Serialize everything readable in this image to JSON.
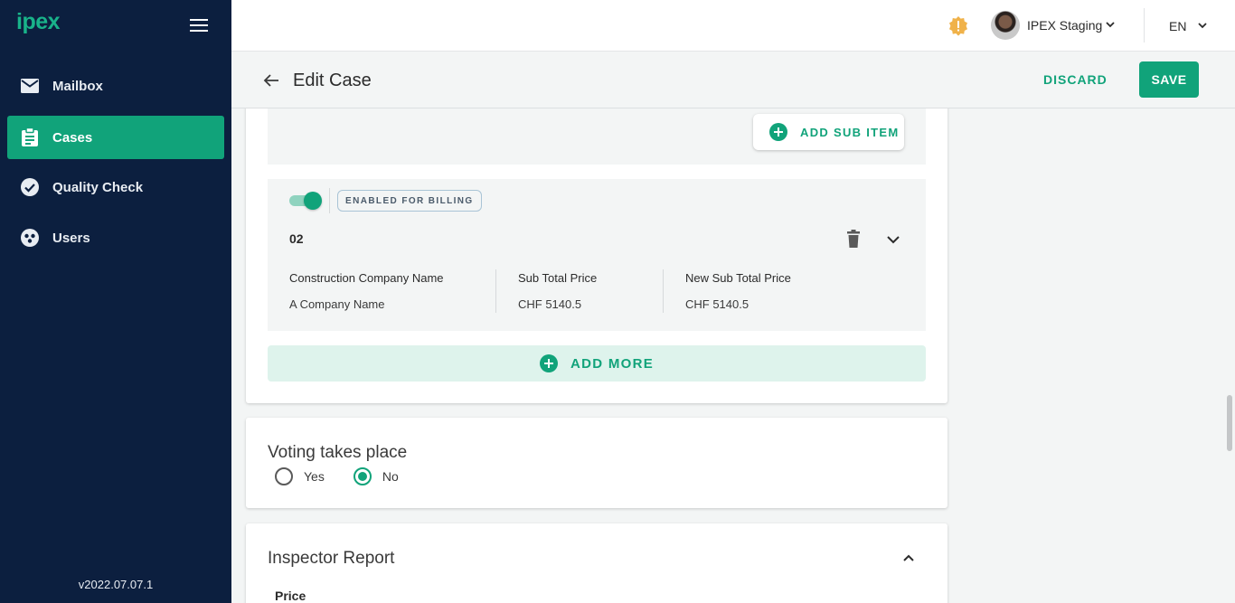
{
  "app": {
    "logo": "ipex",
    "version": "v2022.07.07.1"
  },
  "sidebar": {
    "items": [
      {
        "label": "Mailbox",
        "icon": "mail-icon"
      },
      {
        "label": "Cases",
        "icon": "clipboard-icon",
        "active": true
      },
      {
        "label": "Quality Check",
        "icon": "check-circle-icon"
      },
      {
        "label": "Users",
        "icon": "users-icon"
      }
    ]
  },
  "topbar": {
    "user_name": "IPEX Staging",
    "language": "EN"
  },
  "header": {
    "title": "Edit Case",
    "discard_label": "DISCARD",
    "save_label": "SAVE"
  },
  "sub_item": {
    "add_label": "ADD SUB ITEM"
  },
  "item": {
    "billing_chip": "ENABLED FOR BILLING",
    "billing_enabled": true,
    "number": "02",
    "fields": [
      {
        "label": "Construction Company Name",
        "value": "A Company Name"
      },
      {
        "label": "Sub Total Price",
        "value": "CHF 5140.5"
      },
      {
        "label": "New Sub Total Price",
        "value": "CHF 5140.5"
      }
    ]
  },
  "add_more_label": "ADD MORE",
  "voting": {
    "title": "Voting takes place",
    "options": [
      {
        "label": "Yes",
        "checked": false
      },
      {
        "label": "No",
        "checked": true
      }
    ]
  },
  "inspector": {
    "title": "Inspector Report",
    "price_label": "Price"
  },
  "colors": {
    "accent": "#11a37a",
    "sidebar_bg": "#0c1f3f",
    "badge": "#f0b24a"
  }
}
